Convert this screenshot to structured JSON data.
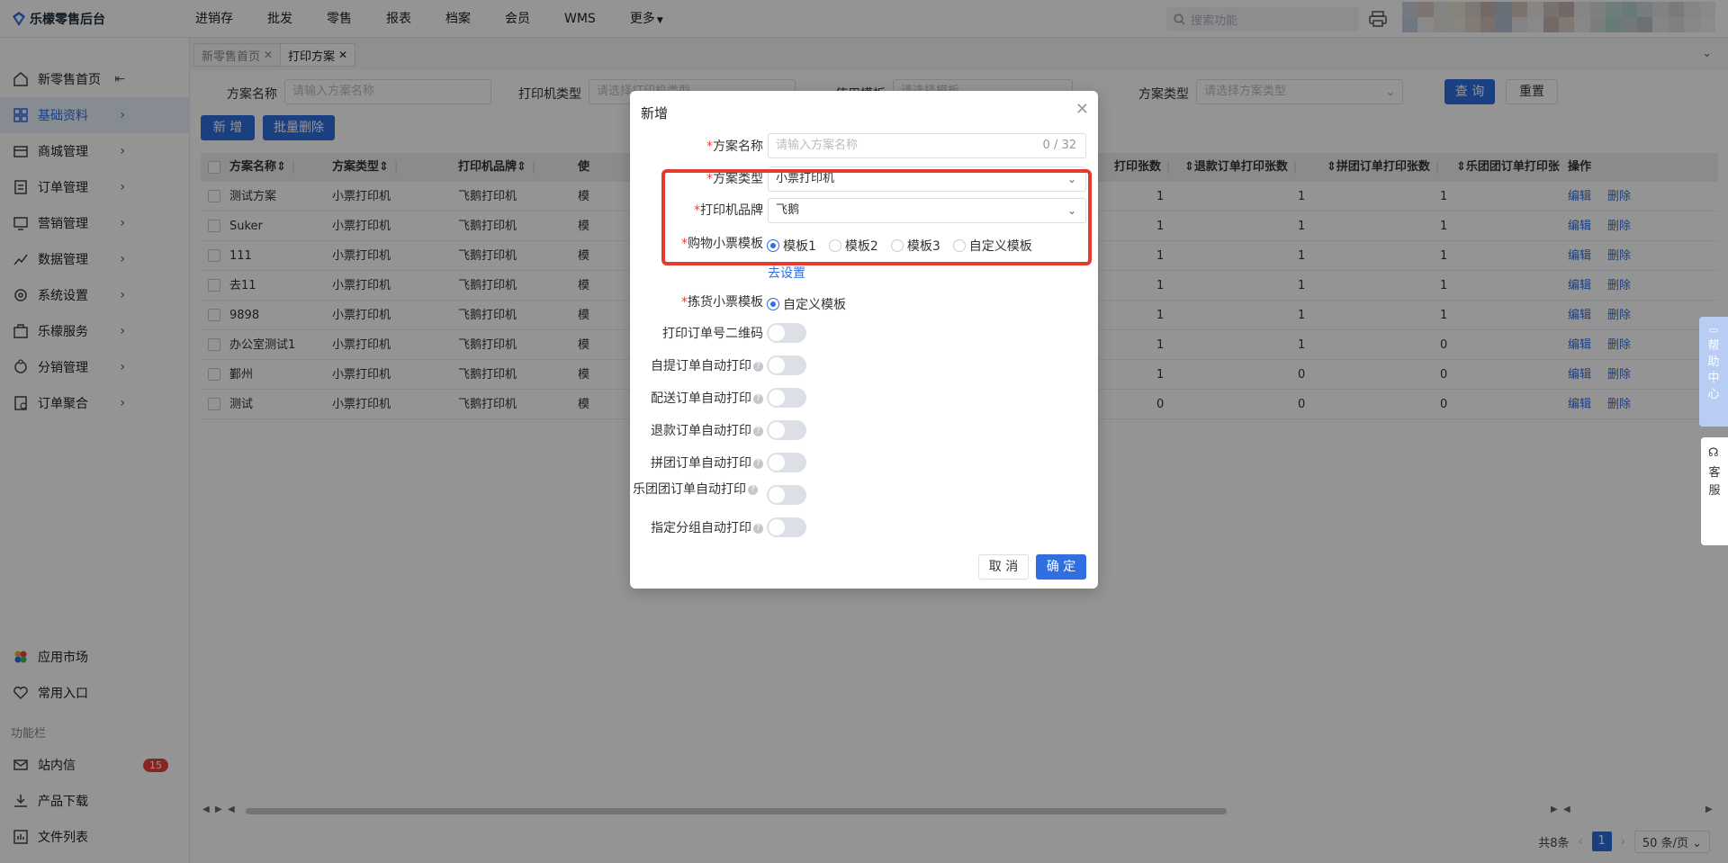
{
  "app": {
    "title": "乐檬零售后台"
  },
  "topnav": [
    "进销存",
    "批发",
    "零售",
    "报表",
    "档案",
    "会员",
    "WMS",
    "更多"
  ],
  "search": {
    "placeholder": "搜索功能"
  },
  "sidebar": {
    "items": [
      {
        "label": "新零售首页",
        "icon": "home-icon"
      },
      {
        "label": "基础资料",
        "icon": "grid-icon"
      },
      {
        "label": "商城管理",
        "icon": "store-icon"
      },
      {
        "label": "订单管理",
        "icon": "order-icon"
      },
      {
        "label": "营销管理",
        "icon": "marketing-icon"
      },
      {
        "label": "数据管理",
        "icon": "chart-icon"
      },
      {
        "label": "系统设置",
        "icon": "settings-icon"
      },
      {
        "label": "乐檬服务",
        "icon": "service-icon"
      },
      {
        "label": "分销管理",
        "icon": "distribution-icon"
      },
      {
        "label": "订单聚合",
        "icon": "aggregate-icon"
      }
    ],
    "bottom": [
      {
        "label": "应用市场",
        "icon": "app-market-icon"
      },
      {
        "label": "常用入口",
        "icon": "heart-icon"
      }
    ],
    "section_label": "功能栏",
    "footer": [
      {
        "label": "站内信",
        "icon": "mail-icon",
        "badge": "15"
      },
      {
        "label": "产品下载",
        "icon": "download-icon"
      },
      {
        "label": "文件列表",
        "icon": "file-list-icon"
      }
    ]
  },
  "tabs": [
    {
      "label": "新零售首页"
    },
    {
      "label": "打印方案"
    }
  ],
  "filters": {
    "name_label": "方案名称",
    "name_placeholder": "请输入方案名称",
    "printer_type_label": "打印机类型",
    "printer_type_placeholder": "请选择打印机类型",
    "template_label": "使用模板",
    "template_placeholder": "请选择模板",
    "scheme_type_label": "方案类型",
    "scheme_type_placeholder": "请选择方案类型",
    "query": "查 询",
    "reset": "重置"
  },
  "actions": {
    "add": "新 增",
    "batch_delete": "批量删除"
  },
  "table": {
    "headers": {
      "name": "方案名称",
      "type": "方案类型",
      "brand": "打印机品牌",
      "use": "使",
      "print_count": "打印张数",
      "refund_count": "退款订单打印张数",
      "group_count": "拼团订单打印张数",
      "legroup_count": "乐团团订单打印张",
      "ops": "操作"
    },
    "rows": [
      {
        "name": "测试方案",
        "type": "小票打印机",
        "brand": "飞鹅打印机",
        "use": "模",
        "c1": "1",
        "c2": "1",
        "c3": "1"
      },
      {
        "name": "Suker",
        "type": "小票打印机",
        "brand": "飞鹅打印机",
        "use": "模",
        "c1": "1",
        "c2": "1",
        "c3": "1"
      },
      {
        "name": "111",
        "type": "小票打印机",
        "brand": "飞鹅打印机",
        "use": "模",
        "c1": "1",
        "c2": "1",
        "c3": "1"
      },
      {
        "name": "去11",
        "type": "小票打印机",
        "brand": "飞鹅打印机",
        "use": "模",
        "c1": "1",
        "c2": "1",
        "c3": "1"
      },
      {
        "name": "9898",
        "type": "小票打印机",
        "brand": "飞鹅打印机",
        "use": "模",
        "c1": "1",
        "c2": "1",
        "c3": "1"
      },
      {
        "name": "办公室测试1",
        "type": "小票打印机",
        "brand": "飞鹅打印机",
        "use": "模",
        "c1": "1",
        "c2": "1",
        "c3": "0"
      },
      {
        "name": "鄞州",
        "type": "小票打印机",
        "brand": "飞鹅打印机",
        "use": "模",
        "c1": "1",
        "c2": "0",
        "c3": "0"
      },
      {
        "name": "测试",
        "type": "小票打印机",
        "brand": "飞鹅打印机",
        "use": "模",
        "c1": "0",
        "c2": "0",
        "c3": "0"
      }
    ],
    "edit": "编辑",
    "delete": "删除"
  },
  "pager": {
    "total": "共8条",
    "page": "1",
    "size": "50 条/页"
  },
  "float": {
    "help": "帮助中心",
    "kefu": "客服"
  },
  "modal": {
    "title": "新增",
    "name_label": "方案名称",
    "name_placeholder": "请输入方案名称",
    "name_count": "0 / 32",
    "type_label": "方案类型",
    "type_value": "小票打印机",
    "brand_label": "打印机品牌",
    "brand_value": "飞鹅",
    "receipt_label": "购物小票模板",
    "receipt_options": [
      "模板1",
      "模板2",
      "模板3",
      "自定义模板"
    ],
    "receipt_selected": 0,
    "set_link": "去设置",
    "pick_label": "拣货小票模板",
    "pick_option": "自定义模板",
    "toggles": [
      {
        "label": "打印订单号二维码",
        "help": false
      },
      {
        "label": "自提订单自动打印",
        "help": true
      },
      {
        "label": "配送订单自动打印",
        "help": true
      },
      {
        "label": "退款订单自动打印",
        "help": true
      },
      {
        "label": "拼团订单自动打印",
        "help": true
      },
      {
        "label": "乐团团订单自动打印",
        "help": true
      },
      {
        "label": "指定分组自动打印",
        "help": true
      }
    ],
    "cancel": "取 消",
    "ok": "确 定"
  },
  "colors": {
    "primary": "#2f6fe0",
    "highlight": "#e63a2e",
    "danger_badge": "#e8413c"
  }
}
